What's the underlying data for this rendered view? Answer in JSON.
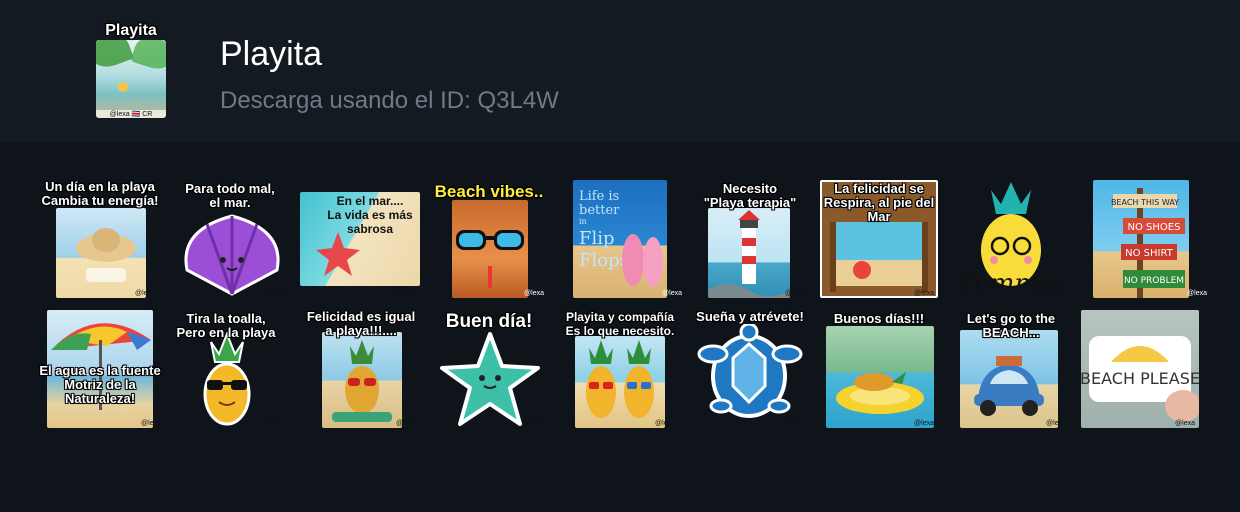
{
  "pack": {
    "thumb_title": "Playita",
    "thumb_signature": "@lexa 🇨🇷 CR",
    "title": "Playita",
    "subtitle": "Descarga usando el ID: Q3L4W"
  },
  "watermark": "@lexa",
  "stickers": [
    {
      "caption": "Un día en la playa\nCambia tu energía!",
      "icon": "beach-hat-sticker"
    },
    {
      "caption": "Para todo mal,\nel mar.",
      "icon": "purple-seashell-sticker"
    },
    {
      "caption": "En el mar....\nLa vida es más\nsabrosa",
      "icon": "starfish-shore-sticker"
    },
    {
      "caption": "Beach vibes..",
      "icon": "cat-sunglasses-sticker"
    },
    {
      "caption": "Life is better in Flip Flops!",
      "icon": "flip-flops-sticker"
    },
    {
      "caption": "Necesito\n\"Playa terapia\"",
      "icon": "lighthouse-sticker"
    },
    {
      "caption": "La felicidad se\nRespira, al pie del\nMar",
      "icon": "window-sea-view-sticker"
    },
    {
      "caption": "Summer",
      "icon": "pineapple-summer-sticker"
    },
    {
      "caption": "BEACH THIS WAY · NO SHOES · NO SHIRT · NO PROBLEM",
      "icon": "beach-signpost-sticker"
    },
    {
      "caption": "El agua es la fuente\nMotriz de la\nNaturaleza!",
      "icon": "beach-umbrella-sticker"
    },
    {
      "caption": "Tira la toalla,\nPero en la playa",
      "icon": "pineapple-cool-sticker"
    },
    {
      "caption": "Felicidad es igual\na playa!!!....",
      "icon": "pineapple-beach-sticker"
    },
    {
      "caption": "Buen día!",
      "icon": "teal-starfish-sticker"
    },
    {
      "caption": "Playita y compañía\nEs lo que necesito.",
      "icon": "pineapple-pair-sticker"
    },
    {
      "caption": "Sueña y atrévete!",
      "icon": "sea-turtle-sticker"
    },
    {
      "caption": "Buenos días!!!",
      "icon": "pineapple-pool-float-sticker"
    },
    {
      "caption": "Let's go to the\nBEACH...",
      "icon": "beetle-car-sticker"
    },
    {
      "caption": "BEACH PLEASE",
      "icon": "beach-please-sticker"
    }
  ]
}
